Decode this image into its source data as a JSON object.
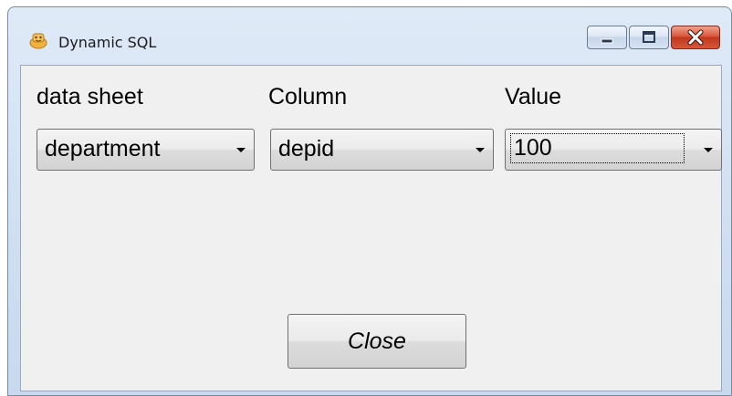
{
  "window": {
    "title": "Dynamic SQL",
    "icon": "app-icon",
    "controls": {
      "minimize": "minimize-icon",
      "maximize": "maximize-icon",
      "close": "close-icon"
    }
  },
  "form": {
    "labels": {
      "sheet": "data sheet",
      "column": "Column",
      "value": "Value"
    },
    "combos": {
      "sheet": "department",
      "column": "depid",
      "value": "100"
    },
    "close_label": "Close"
  },
  "colors": {
    "close_button": "#c2371d",
    "window_frame": "#cfdff1",
    "client_bg": "#f0f0f0"
  }
}
